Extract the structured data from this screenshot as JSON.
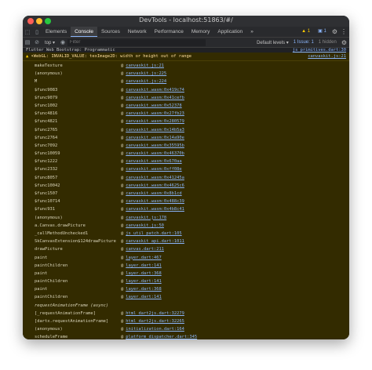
{
  "window": {
    "title": "DevTools - localhost:51863/#/"
  },
  "tabs": [
    "Elements",
    "Console",
    "Sources",
    "Network",
    "Performance",
    "Memory",
    "Application"
  ],
  "more_tabs": "»",
  "badges": {
    "warnings": "1",
    "info": "1"
  },
  "filter_bar": {
    "context": "top",
    "filter_placeholder": "Filter",
    "levels": "Default levels",
    "issues": "1 Issue: 1",
    "hidden": "1 hidden"
  },
  "console": {
    "partial_line": {
      "text": "Flutter Web Bootstrap: Programmatic",
      "link": "js_primitives.dart:30"
    },
    "warning": {
      "message": "WebGL: INVALID_VALUE: texImage2D: width or height out of range",
      "link": "canvaskit.js:21"
    },
    "at_symbol": "@",
    "frames": [
      {
        "fn": "makeTexture",
        "loc": "canvaskit.js:21"
      },
      {
        "fn": "(anonymous)",
        "loc": "canvaskit.js:225"
      },
      {
        "fn": "M",
        "loc": "canvaskit.js:224"
      },
      {
        "fn": "$func9083",
        "loc": "canvaskit.wasm:0x419c74"
      },
      {
        "fn": "$func9079",
        "loc": "canvaskit.wasm:0x41cefb"
      },
      {
        "fn": "$func1002",
        "loc": "canvaskit.wasm:0x52378"
      },
      {
        "fn": "$func4816",
        "loc": "canvaskit.wasm:0x27fb23"
      },
      {
        "fn": "$func4821",
        "loc": "canvaskit.wasm:0x280579"
      },
      {
        "fn": "$func2765",
        "loc": "canvaskit.wasm:0x14b5a3"
      },
      {
        "fn": "$func2764",
        "loc": "canvaskit.wasm:0x14a90e"
      },
      {
        "fn": "$func7092",
        "loc": "canvaskit.wasm:0x35595b"
      },
      {
        "fn": "$func10059",
        "loc": "canvaskit.wasm:0x46370b"
      },
      {
        "fn": "$func1222",
        "loc": "canvaskit.wasm:0x670aa"
      },
      {
        "fn": "$func2332",
        "loc": "canvaskit.wasm:0xff08e"
      },
      {
        "fn": "$func8057",
        "loc": "canvaskit.wasm:0x41245a"
      },
      {
        "fn": "$func10042",
        "loc": "canvaskit.wasm:0x4625c6"
      },
      {
        "fn": "$func1507",
        "loc": "canvaskit.wasm:0x8b1cd"
      },
      {
        "fn": "$func10714",
        "loc": "canvaskit.wasm:0x488c39"
      },
      {
        "fn": "$func931",
        "loc": "canvaskit.wasm:0x4b8c41"
      },
      {
        "fn": "(anonymous)",
        "loc": "canvaskit.js:178"
      },
      {
        "fn": "a.Canvas.drawPicture",
        "loc": "canvaskit.js:50"
      },
      {
        "fn": "_callMethodUnchecked1",
        "loc": "js_util_patch.dart:105"
      },
      {
        "fn": "SkCanvasExtension$124drawPicture",
        "loc": "canvaskit_api.dart:1011"
      },
      {
        "fn": "drawPicture",
        "loc": "canvas.dart:211"
      },
      {
        "fn": "paint",
        "loc": "layer.dart:467"
      },
      {
        "fn": "paintChildren",
        "loc": "layer.dart:141"
      },
      {
        "fn": "paint",
        "loc": "layer.dart:368"
      },
      {
        "fn": "paintChildren",
        "loc": "layer.dart:141"
      },
      {
        "fn": "paint",
        "loc": "layer.dart:368"
      },
      {
        "fn": "paintChildren",
        "loc": "layer.dart:141"
      },
      {
        "fn": "requestAnimationFrame (async)",
        "loc": "",
        "async": true
      },
      {
        "fn": "[_requestAnimationFrame]",
        "loc": "html_dart2js.dart:32279"
      },
      {
        "fn": "[dartx.requestAnimationFrame]",
        "loc": "html_dart2js.dart:32265"
      },
      {
        "fn": "(anonymous)",
        "loc": "initialization.dart:164"
      },
      {
        "fn": "scheduleFrame",
        "loc": "platform_dispatcher.dart:345"
      }
    ]
  }
}
